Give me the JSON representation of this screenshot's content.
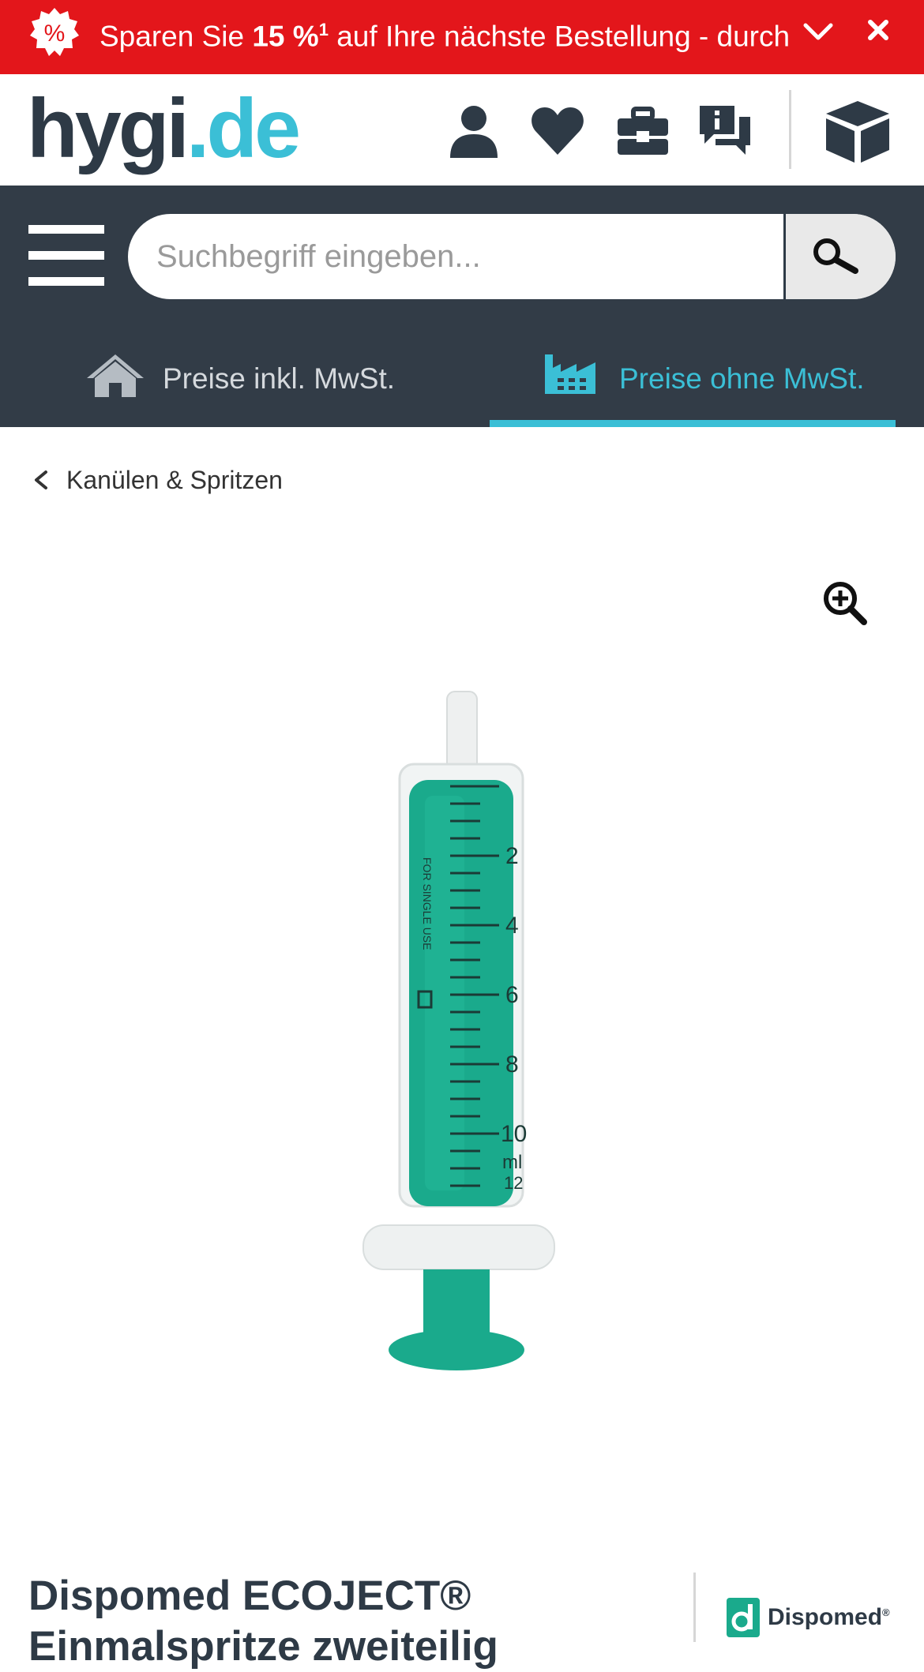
{
  "promo": {
    "text_before": "Sparen Sie ",
    "highlight": "15 %",
    "footnote": "1",
    "text_after": " auf Ihre nächste Bestellung - durch A...",
    "badge_symbol": "%",
    "background": "#e3161b"
  },
  "header": {
    "logo_part1": "hygi",
    "logo_part2": ".de",
    "icons": [
      "user-icon",
      "heart-icon",
      "toolbox-icon",
      "chat-icon",
      "box-icon"
    ]
  },
  "search": {
    "placeholder": "Suchbegriff eingeben..."
  },
  "price_tabs": {
    "incl_label": "Preise inkl. MwSt.",
    "excl_label": "Preise ohne MwSt.",
    "active": "excl"
  },
  "breadcrumb": {
    "label": "Kanülen & Spritzen"
  },
  "product": {
    "title": "Dispomed ECOJECT® Einmalspritze zweiteilig",
    "brand": "Dispomed",
    "brand_mark": "®",
    "syringe_label": "FOR SINGLE USE",
    "scale_marks": [
      "2",
      "4",
      "6",
      "8",
      "10",
      "ml",
      "12"
    ]
  },
  "colors": {
    "accent": "#3bbfd6",
    "dark": "#323c47",
    "promo_red": "#e3161b",
    "syringe_green": "#1aaa8c"
  }
}
